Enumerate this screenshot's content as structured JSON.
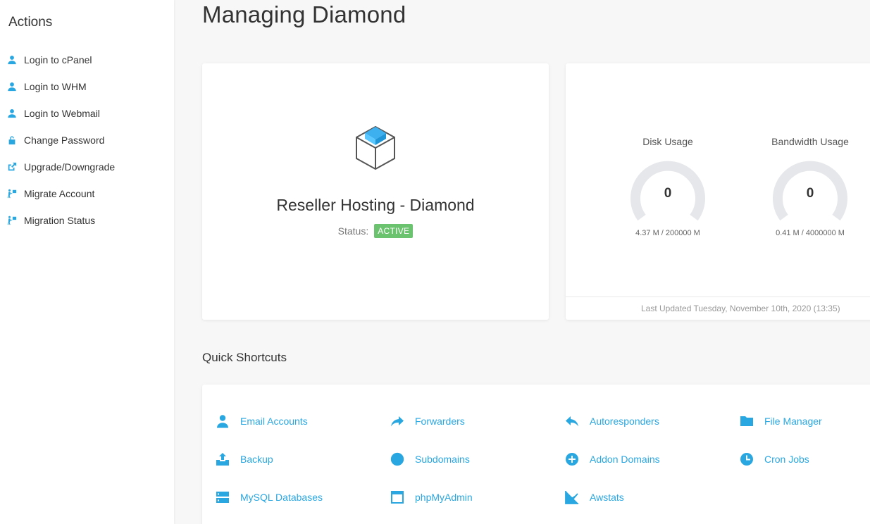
{
  "sidebar": {
    "title": "Actions",
    "items": [
      {
        "label": "Login to cPanel",
        "icon": "user-icon"
      },
      {
        "label": "Login to WHM",
        "icon": "user-icon"
      },
      {
        "label": "Login to Webmail",
        "icon": "user-icon"
      },
      {
        "label": "Change Password",
        "icon": "unlock-icon"
      },
      {
        "label": "Upgrade/Downgrade",
        "icon": "external-link-icon"
      },
      {
        "label": "Migrate Account",
        "icon": "migrate-icon"
      },
      {
        "label": "Migration Status",
        "icon": "migrate-icon"
      }
    ]
  },
  "page": {
    "title": "Managing Diamond"
  },
  "product": {
    "name": "Reseller Hosting - Diamond",
    "status_label": "Status:",
    "status_value": "ACTIVE",
    "icon": "cube-icon"
  },
  "usage": {
    "disk": {
      "label": "Disk Usage",
      "value": "0",
      "sub": "4.37 M / 200000 M"
    },
    "bandwidth": {
      "label": "Bandwidth Usage",
      "value": "0",
      "sub": "0.41 M / 4000000 M"
    },
    "last_updated": "Last Updated Tuesday, November 10th, 2020 (13:35)"
  },
  "shortcuts": {
    "title": "Quick Shortcuts",
    "items": [
      {
        "label": "Email Accounts",
        "icon": "user-icon"
      },
      {
        "label": "Forwarders",
        "icon": "forward-arrow-icon"
      },
      {
        "label": "Autoresponders",
        "icon": "reply-icon"
      },
      {
        "label": "File Manager",
        "icon": "folder-icon"
      },
      {
        "label": "Backup",
        "icon": "upload-icon"
      },
      {
        "label": "Subdomains",
        "icon": "globe-icon"
      },
      {
        "label": "Addon Domains",
        "icon": "plus-circle-icon"
      },
      {
        "label": "Cron Jobs",
        "icon": "clock-icon"
      },
      {
        "label": "MySQL Databases",
        "icon": "server-icon"
      },
      {
        "label": "phpMyAdmin",
        "icon": "window-icon"
      },
      {
        "label": "Awstats",
        "icon": "line-chart-icon"
      }
    ]
  },
  "colors": {
    "accent": "#29a7e1",
    "status_active": "#6cc36f",
    "gauge_track": "#e6e7ea"
  }
}
